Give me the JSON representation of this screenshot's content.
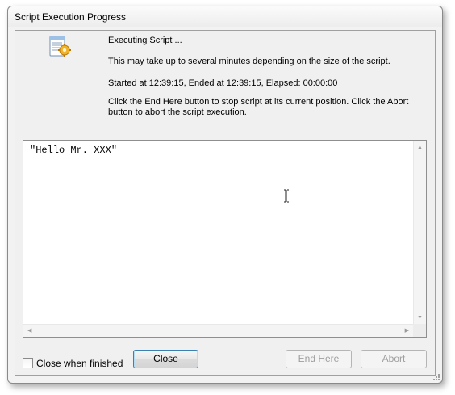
{
  "window": {
    "title": "Script Execution Progress"
  },
  "header": {
    "icon": "script-gear-icon",
    "status_line": "Executing Script ...",
    "duration_note": "This may take up to several minutes depending on the size of the script.",
    "timing_line": "Started at 12:39:15, Ended at 12:39:15,  Elapsed: 00:00:00",
    "instructions": "Click the End Here button to stop script at its current position. Click the Abort button to abort the script execution."
  },
  "output": {
    "text": "\"Hello Mr. XXX\""
  },
  "footer": {
    "close_when_finished_label": "Close when finished",
    "close_when_finished_checked": false,
    "close_button": "Close",
    "end_here_button": "End Here",
    "abort_button": "Abort"
  }
}
